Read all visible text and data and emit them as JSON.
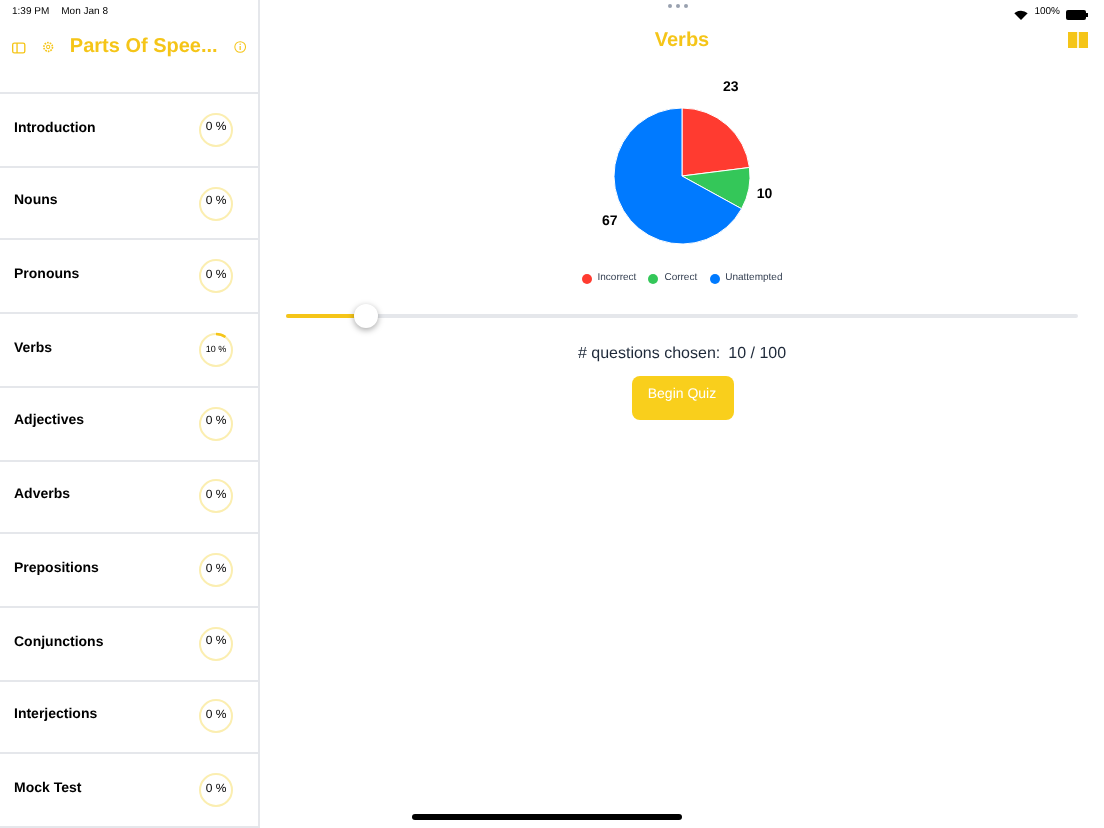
{
  "status_bar": {
    "time": "1:39 PM",
    "date": "Mon Jan 8",
    "battery": "100%"
  },
  "sidebar": {
    "title": "Parts Of Spee...",
    "items": [
      {
        "label": "Introduction",
        "percent": "0 %"
      },
      {
        "label": "Nouns",
        "percent": "0 %"
      },
      {
        "label": "Pronouns",
        "percent": "0 %"
      },
      {
        "label": "Verbs",
        "percent": "10 %"
      },
      {
        "label": "Adjectives",
        "percent": "0 %"
      },
      {
        "label": "Adverbs",
        "percent": "0 %"
      },
      {
        "label": "Prepositions",
        "percent": "0 %"
      },
      {
        "label": "Conjunctions",
        "percent": "0 %"
      },
      {
        "label": "Interjections",
        "percent": "0 %"
      },
      {
        "label": "Mock Test",
        "percent": "0 %"
      }
    ]
  },
  "detail": {
    "title": "Verbs",
    "chart_data": {
      "type": "pie",
      "categories": [
        "Incorrect",
        "Correct",
        "Unattempted"
      ],
      "values": [
        23,
        10,
        67
      ],
      "data_labels": true
    },
    "legend": [
      {
        "color": "#ff3b30"
      },
      {
        "color": "#34c759"
      },
      {
        "color": "#007aff"
      }
    ],
    "slider": {
      "level": 0.1
    },
    "questions_label": "# questions chosen:",
    "questions_value": "10 / 100",
    "button": "Begin Quiz"
  }
}
